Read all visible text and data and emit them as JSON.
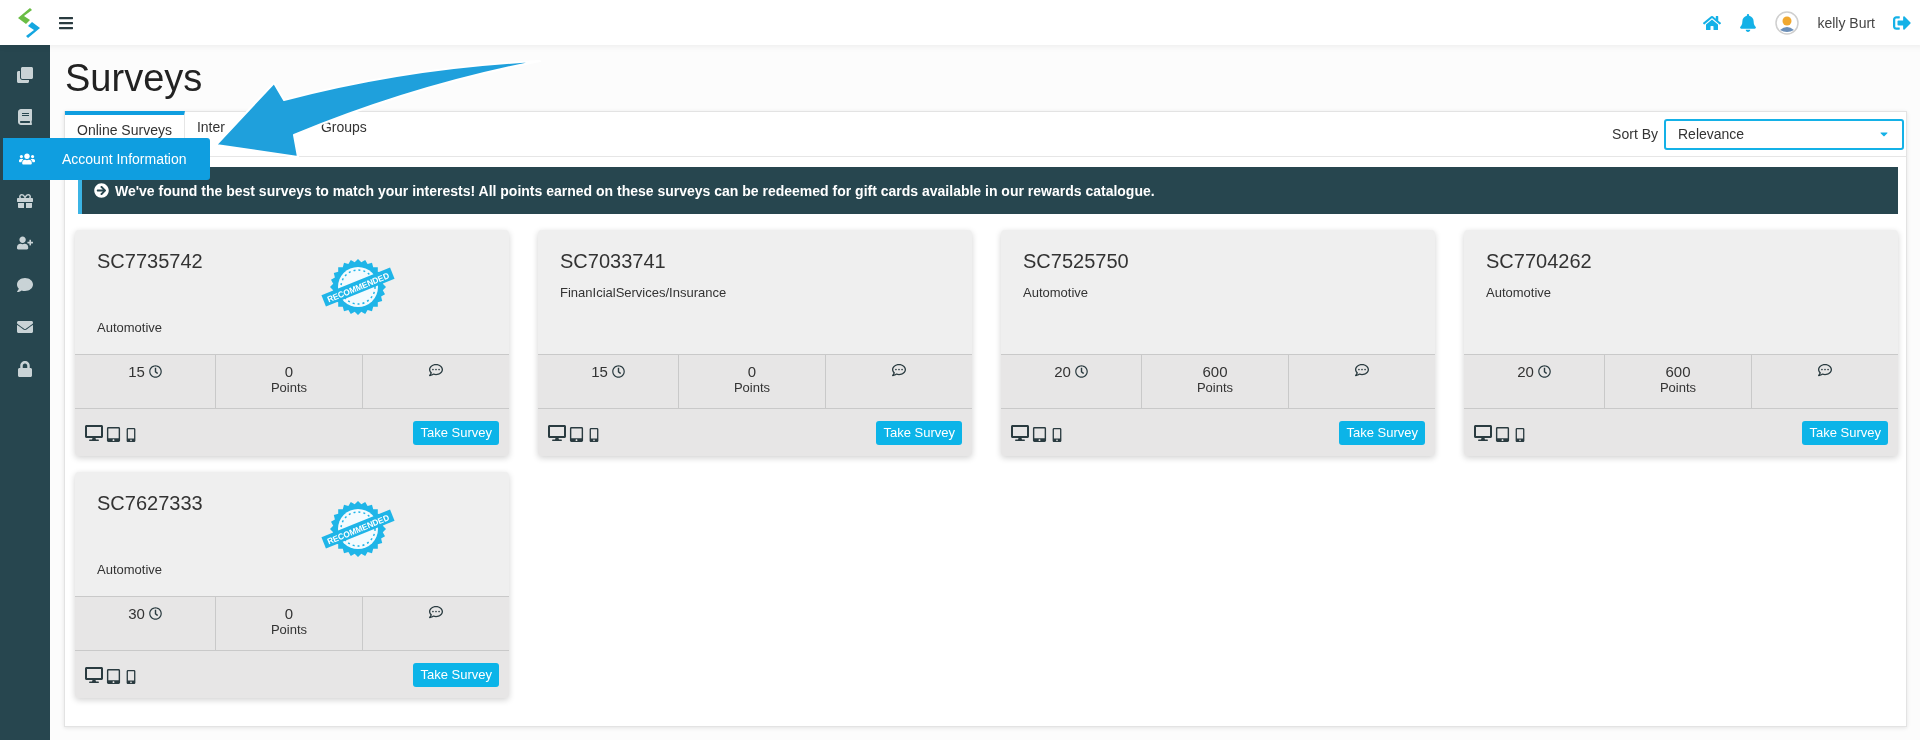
{
  "header": {
    "user_name": "kelly Burt"
  },
  "sidebar": {
    "items": [
      {
        "selected": false
      },
      {
        "selected": false
      },
      {
        "selected": true,
        "tooltip": "Account Information"
      },
      {
        "selected": false
      },
      {
        "selected": false
      },
      {
        "selected": false
      },
      {
        "selected": false
      },
      {
        "selected": false
      }
    ]
  },
  "page_title": "Surveys",
  "tabs": [
    {
      "label_parts": [
        "Online Surveys"
      ],
      "selected": true
    },
    {
      "label_parts": [
        "Inter",
        "Groups"
      ],
      "selected": false
    }
  ],
  "sort": {
    "label": "Sort By",
    "value": "Relevance"
  },
  "banner": "We've found the best surveys to match your interests! All points earned on these surveys can be redeemed for gift cards available in our rewards catalogue.",
  "cards": [
    {
      "id": "SC7735742",
      "badge": "RECOMMENDED",
      "category": "Automotive",
      "minutes": "15",
      "points": "0",
      "points_label": "Points",
      "button": "Take Survey"
    },
    {
      "id": "SC7033741",
      "category": "FinanIcialServices/Insurance",
      "minutes": "15",
      "points": "0",
      "points_label": "Points",
      "button": "Take Survey"
    },
    {
      "id": "SC7525750",
      "category": "Automotive",
      "minutes": "20",
      "points": "600",
      "points_label": "Points",
      "button": "Take Survey"
    },
    {
      "id": "SC7704262",
      "category": "Automotive",
      "minutes": "20",
      "points": "600",
      "points_label": "Points",
      "button": "Take Survey"
    },
    {
      "id": "SC7627333",
      "badge": "RECOMMENDED",
      "category": "Automotive",
      "minutes": "30",
      "points": "0",
      "points_label": "Points",
      "button": "Take Survey"
    }
  ]
}
